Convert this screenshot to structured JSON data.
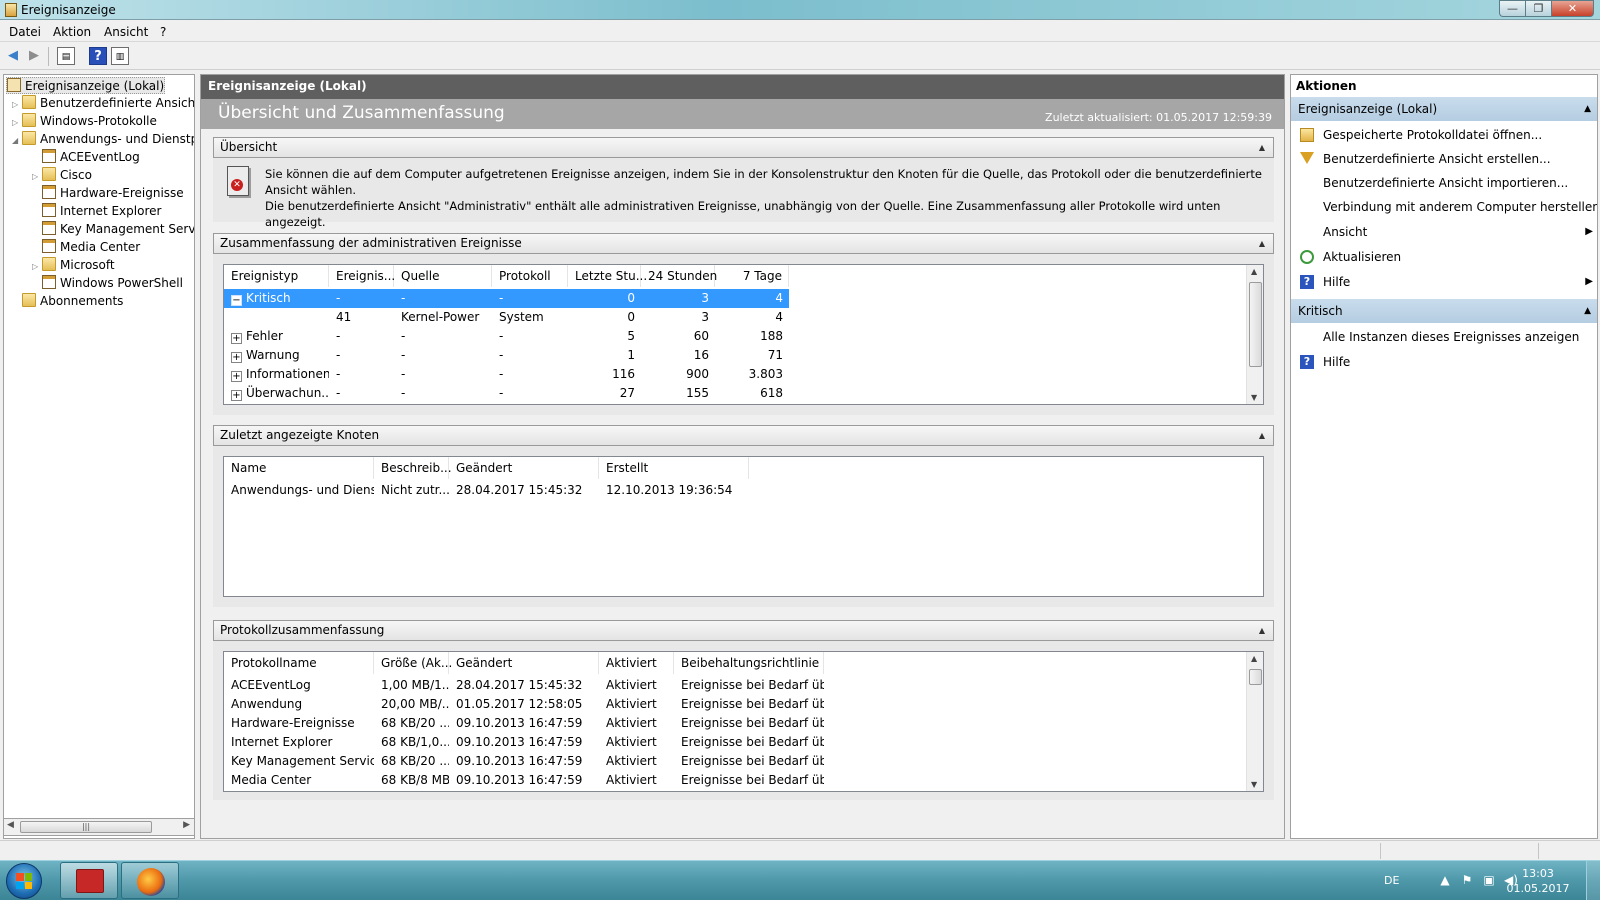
{
  "window": {
    "title": "Ereignisanzeige",
    "min": "—",
    "max": "❐",
    "close": "✕"
  },
  "menu": [
    "Datei",
    "Aktion",
    "Ansicht",
    "?"
  ],
  "tree": {
    "items": [
      {
        "label": "Ereignisanzeige (Lokal)",
        "level": 0,
        "icon": "root-icon",
        "exp": ""
      },
      {
        "label": "Benutzerdefinierte Ansichten",
        "level": 1,
        "icon": "folder-filter-icon",
        "exp": "▷"
      },
      {
        "label": "Windows-Protokolle",
        "level": 1,
        "icon": "folder-logs-icon",
        "exp": "▷"
      },
      {
        "label": "Anwendungs- und Dienstprotokolle",
        "level": 1,
        "icon": "folder-logs-icon",
        "exp": "◢"
      },
      {
        "label": "ACEEventLog",
        "level": 2,
        "icon": "log-icon",
        "exp": ""
      },
      {
        "label": "Cisco",
        "level": 2,
        "icon": "folder-icon",
        "exp": "▷"
      },
      {
        "label": "Hardware-Ereignisse",
        "level": 2,
        "icon": "log-icon",
        "exp": ""
      },
      {
        "label": "Internet Explorer",
        "level": 2,
        "icon": "log-icon",
        "exp": ""
      },
      {
        "label": "Key Management Service",
        "level": 2,
        "icon": "log-icon",
        "exp": ""
      },
      {
        "label": "Media Center",
        "level": 2,
        "icon": "log-icon",
        "exp": ""
      },
      {
        "label": "Microsoft",
        "level": 2,
        "icon": "folder-icon",
        "exp": "▷"
      },
      {
        "label": "Windows PowerShell",
        "level": 2,
        "icon": "log-icon",
        "exp": ""
      },
      {
        "label": "Abonnements",
        "level": 1,
        "icon": "subscriptions-icon",
        "exp": ""
      }
    ]
  },
  "center": {
    "header": "Ereignisanzeige (Lokal)",
    "banner_title": "Übersicht und Zusammenfassung",
    "updated": "Zuletzt aktualisiert: 01.05.2017 12:59:39",
    "overview": {
      "title": "Übersicht",
      "text1": "Sie können die auf dem Computer aufgetretenen Ereignisse anzeigen, indem Sie in der Konsolenstruktur den Knoten für die Quelle, das Protokoll oder die benutzerdefinierte Ansicht wählen.",
      "text2": "Die benutzerdefinierte Ansicht \"Administrativ\" enthält alle administrativen Ereignisse, unabhängig von der Quelle. Eine Zusammenfassung aller Protokolle wird unten angezeigt."
    },
    "admin_summary": {
      "title": "Zusammenfassung der administrativen Ereignisse",
      "columns": [
        "Ereignistyp",
        "Ereignis...",
        "Quelle",
        "Protokoll",
        "Letzte Stu...",
        "24 Stunden",
        "7 Tage"
      ],
      "rows": [
        {
          "pm": "−",
          "type": "Kritisch",
          "id": "-",
          "source": "-",
          "log": "-",
          "hour": "0",
          "day": "3",
          "week": "4",
          "selected": true
        },
        {
          "pm": "",
          "type": "",
          "id": "41",
          "source": "Kernel-Power",
          "log": "System",
          "hour": "0",
          "day": "3",
          "week": "4"
        },
        {
          "pm": "+",
          "type": "Fehler",
          "id": "-",
          "source": "-",
          "log": "-",
          "hour": "5",
          "day": "60",
          "week": "188"
        },
        {
          "pm": "+",
          "type": "Warnung",
          "id": "-",
          "source": "-",
          "log": "-",
          "hour": "1",
          "day": "16",
          "week": "71"
        },
        {
          "pm": "+",
          "type": "Informationen",
          "id": "-",
          "source": "-",
          "log": "-",
          "hour": "116",
          "day": "900",
          "week": "3.803"
        },
        {
          "pm": "+",
          "type": "Überwachun...",
          "id": "-",
          "source": "-",
          "log": "-",
          "hour": "27",
          "day": "155",
          "week": "618"
        }
      ]
    },
    "recent_nodes": {
      "title": "Zuletzt angezeigte Knoten",
      "columns": [
        "Name",
        "Beschreib...",
        "Geändert",
        "Erstellt"
      ],
      "rows": [
        {
          "name": "Anwendungs- und Diens...",
          "desc": "Nicht zutr...",
          "changed": "28.04.2017 15:45:32",
          "created": "12.10.2013 19:36:54"
        }
      ]
    },
    "log_summary": {
      "title": "Protokollzusammenfassung",
      "columns": [
        "Protokollname",
        "Größe (Ak...",
        "Geändert",
        "Aktiviert",
        "Beibehaltungsrichtlinie"
      ],
      "rows": [
        {
          "name": "ACEEventLog",
          "size": "1,00 MB/1...",
          "changed": "28.04.2017 15:45:32",
          "enabled": "Aktiviert",
          "policy": "Ereignisse bei Bedarf üb..."
        },
        {
          "name": "Anwendung",
          "size": "20,00 MB/...",
          "changed": "01.05.2017 12:58:05",
          "enabled": "Aktiviert",
          "policy": "Ereignisse bei Bedarf üb..."
        },
        {
          "name": "Hardware-Ereignisse",
          "size": "68 KB/20 ...",
          "changed": "09.10.2013 16:47:59",
          "enabled": "Aktiviert",
          "policy": "Ereignisse bei Bedarf üb..."
        },
        {
          "name": "Internet Explorer",
          "size": "68 KB/1,0...",
          "changed": "09.10.2013 16:47:59",
          "enabled": "Aktiviert",
          "policy": "Ereignisse bei Bedarf üb..."
        },
        {
          "name": "Key Management Service",
          "size": "68 KB/20 ...",
          "changed": "09.10.2013 16:47:59",
          "enabled": "Aktiviert",
          "policy": "Ereignisse bei Bedarf üb..."
        },
        {
          "name": "Media Center",
          "size": "68 KB/8 MB",
          "changed": "09.10.2013 16:47:59",
          "enabled": "Aktiviert",
          "policy": "Ereignisse bei Bedarf üb..."
        }
      ]
    }
  },
  "actions": {
    "title": "Aktionen",
    "groups": [
      {
        "label": "Ereignisanzeige (Lokal)",
        "items": [
          {
            "label": "Gespeicherte Protokolldatei öffnen...",
            "icon": "open-log-icon",
            "submenu": false
          },
          {
            "label": "Benutzerdefinierte Ansicht erstellen...",
            "icon": "filter-icon",
            "submenu": false
          },
          {
            "label": "Benutzerdefinierte Ansicht importieren...",
            "icon": "",
            "submenu": false
          },
          {
            "label": "Verbindung mit anderem Computer herstellen...",
            "icon": "",
            "submenu": false
          },
          {
            "label": "Ansicht",
            "icon": "",
            "submenu": true
          },
          {
            "label": "Aktualisieren",
            "icon": "refresh-icon",
            "submenu": false
          },
          {
            "label": "Hilfe",
            "icon": "help-icon",
            "submenu": true
          }
        ]
      },
      {
        "label": "Kritisch",
        "items": [
          {
            "label": "Alle Instanzen dieses Ereignisses anzeigen",
            "icon": "",
            "submenu": false
          },
          {
            "label": "Hilfe",
            "icon": "help-icon",
            "submenu": false
          }
        ]
      }
    ]
  },
  "taskbar": {
    "lang": "DE",
    "time": "13:03",
    "date": "01.05.2017"
  }
}
